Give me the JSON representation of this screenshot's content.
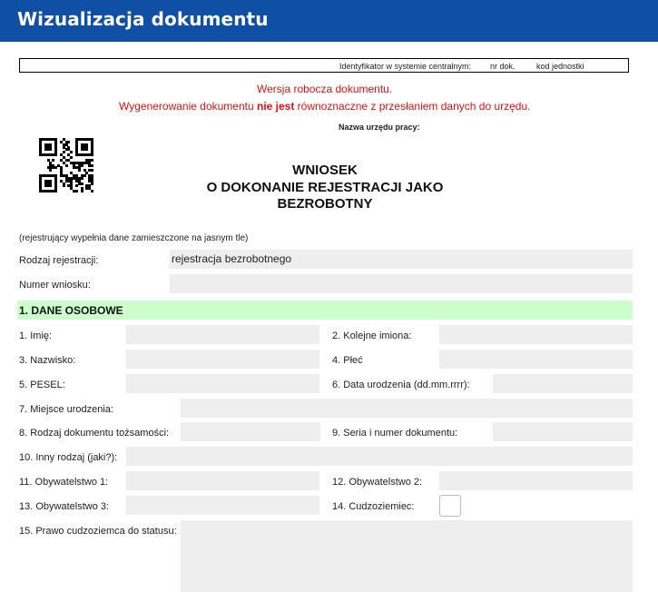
{
  "app": {
    "title": "Wizualizacja dokumentu"
  },
  "identifier": {
    "label": "Identyfikator w systemie centralnym:",
    "doc_no": "nr dok.",
    "unit_code": "kod jednostki"
  },
  "notices": {
    "draft": "Wersja robocza dokumentu.",
    "gen_before": "Wygenerowanie dokumentu ",
    "gen_bold": "nie jest",
    "gen_after": " równoznaczne z przesłaniem danych do urzędu."
  },
  "office_label": "Nazwa urzędu pracy:",
  "doc_title": {
    "line1": "WNIOSEK",
    "line2": "O DOKONANIE REJESTRACJI JAKO",
    "line3": "BEZROBOTNY"
  },
  "hint": "(rejestrujący wypełnia dane zamieszczone na jasnym tle)",
  "registration": {
    "type_label": "Rodzaj rejestracji:",
    "type_value": "rejestracja bezrobotnego",
    "number_label": "Numer wniosku:",
    "number_value": ""
  },
  "section1": {
    "title": "1. DANE OSOBOWE",
    "fields": {
      "first_name": "1. Imię:",
      "middle_names": "2. Kolejne imiona:",
      "last_name": "3. Nazwisko:",
      "sex": "4. Płeć",
      "pesel": "5. PESEL:",
      "birth_date": "6. Data urodzenia (dd.mm.rrrr):",
      "birth_place": "7. Miejsce urodzenia:",
      "id_doc_type": "8. Rodzaj dokumentu tożsamości:",
      "id_doc_number": "9. Seria i numer dokumentu:",
      "other_type": "10. Inny rodzaj (jaki?):",
      "citizenship1": "11. Obywatelstwo 1:",
      "citizenship2": "12. Obywatelstwo 2:",
      "citizenship3": "13. Obywatelstwo 3:",
      "foreigner": "14. Cudzoziemiec:",
      "foreigner_status": "15. Prawo cudzoziemca do statusu:"
    }
  },
  "colors": {
    "header_bg": "#0f4fa4",
    "section_bg": "#ccffcc",
    "field_bg": "#eeeeee",
    "notice_red": "#e01010"
  },
  "icons": {
    "qr": "qr-code-icon"
  }
}
